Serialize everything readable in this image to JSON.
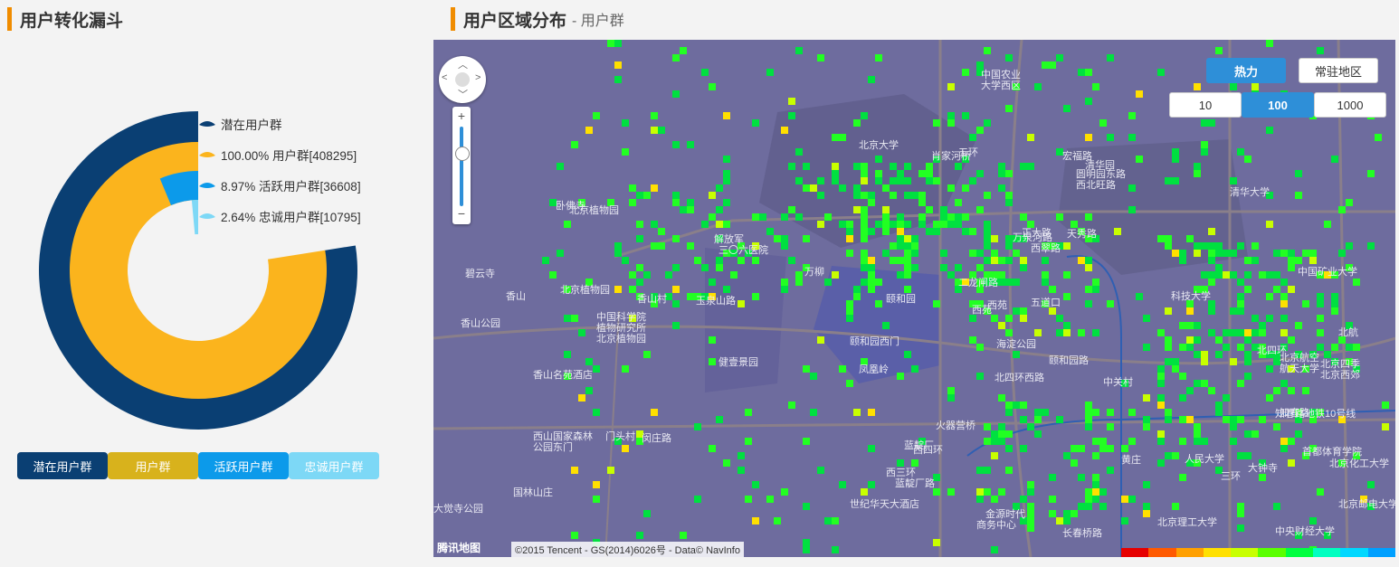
{
  "left_panel": {
    "title": "用户转化漏斗",
    "legend": [
      {
        "label": "潜在用户群",
        "color": "#0a3f73"
      },
      {
        "label": "100.00% 用户群[408295]",
        "color": "#fbb41d"
      },
      {
        "label": "8.97% 活跃用户群[36608]",
        "color": "#0c9aea"
      },
      {
        "label": "2.64% 忠诚用户群[10795]",
        "color": "#7dd8f6"
      }
    ],
    "chart_data": {
      "type": "pie",
      "series": [
        {
          "name": "潜在用户群",
          "value": null
        },
        {
          "name": "用户群",
          "value": 408295,
          "percent": 100.0
        },
        {
          "name": "活跃用户群",
          "value": 36608,
          "percent": 8.97
        },
        {
          "name": "忠诚用户群",
          "value": 10795,
          "percent": 2.64
        }
      ]
    },
    "buttons": [
      {
        "label": "潜在用户群",
        "color": "#0a3f73"
      },
      {
        "label": "用户群",
        "color": "#d8b21c"
      },
      {
        "label": "活跃用户群",
        "color": "#0c9aea"
      },
      {
        "label": "忠诚用户群",
        "color": "#7dd8f6"
      }
    ]
  },
  "right_panel": {
    "title": "用户区域分布",
    "subtitle": "- 用户群",
    "mode_buttons": [
      {
        "label": "热力",
        "active": true
      },
      {
        "label": "常驻地区",
        "active": false
      }
    ],
    "scale_buttons": [
      {
        "label": "10",
        "active": false
      },
      {
        "label": "100",
        "active": true
      },
      {
        "label": "1000",
        "active": false
      }
    ],
    "map_labels": [
      "北京植物园",
      "卧佛寺",
      "碧云寺",
      "香山",
      "香山公园",
      "北京植物园",
      "香山村",
      "中国科学院",
      "植物研究所",
      "北京植物园",
      "香山名苑酒店",
      "西山国家森林",
      "公园东门",
      "门头村",
      "闵庄路",
      "大觉寺公园",
      "国林山庄",
      "玉泉山路",
      "健壹景园",
      "解放军",
      "三〇六医院",
      "万柳",
      "颐和园",
      "颐和园西门",
      "凤凰岭",
      "西苑",
      "海淀公园",
      "万泉河路",
      "颐和园路",
      "中国农业",
      "大学西区",
      "北京大学",
      "清华大学",
      "清华园",
      "五道口",
      "中关村",
      "知春路",
      "人民大学",
      "北京理工大学",
      "中央财经大学",
      "首都体育学院",
      "大钟寺",
      "北航",
      "北京航空",
      "航天大学",
      "中国矿业大学",
      "科技大学",
      "火器营桥",
      "蓝靛厂路",
      "世纪华天大酒店",
      "金源时代",
      "商务中心",
      "长春桥路",
      "西四环",
      "西三环",
      "北四环西路",
      "北四环",
      "三环",
      "肖家河桥",
      "五环",
      "二龙闸路",
      "正大路",
      "天秀路",
      "宏福路",
      "圆明园东路",
      "西北旺路",
      "北京四季",
      "北京西郊",
      "知春路地铁10号线",
      "西苑",
      "北京化工大学",
      "北京邮电大学",
      "黄庄",
      "蓝靛厂",
      "西翠路"
    ],
    "copyright": "©2015 Tencent - GS(2014)6026号 - Data© NavInfo",
    "logo": "腾讯地图"
  }
}
